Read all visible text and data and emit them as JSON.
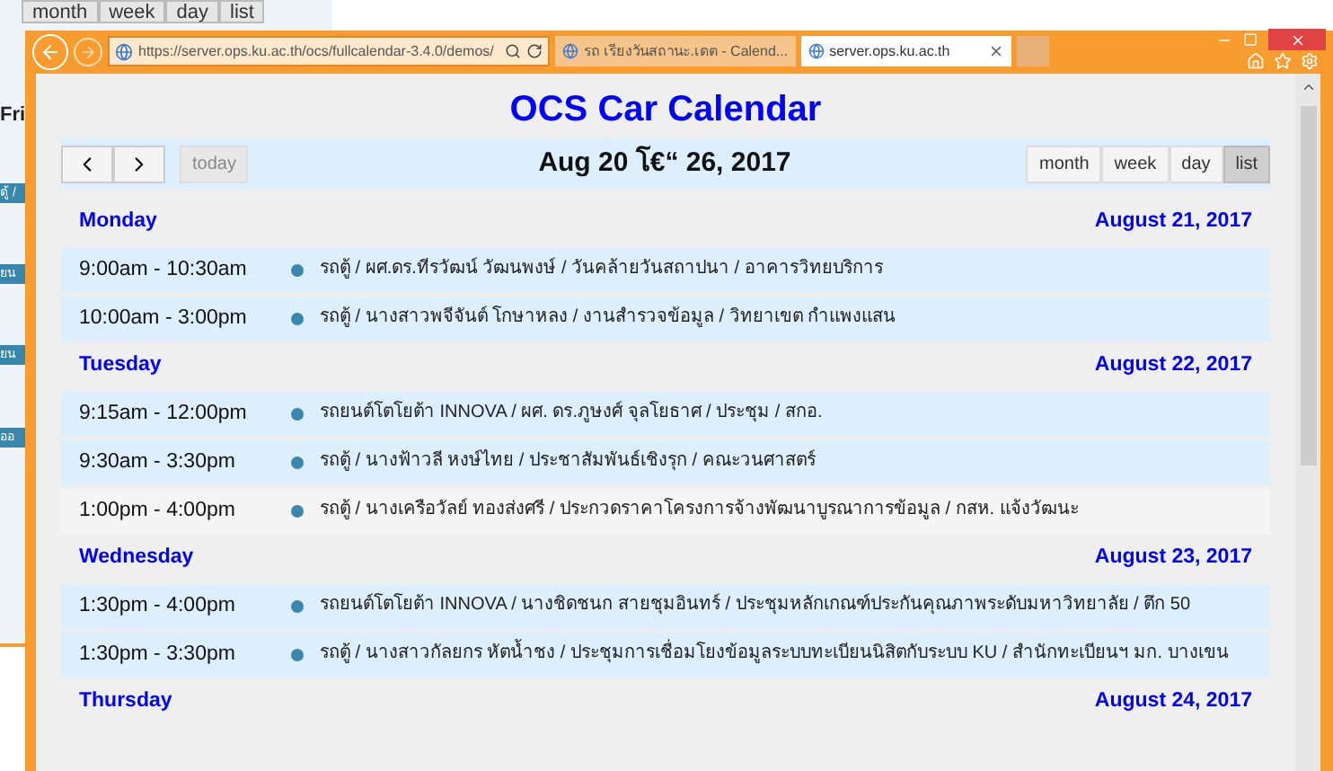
{
  "background_window": {
    "view_buttons": [
      "month",
      "week",
      "day",
      "list"
    ],
    "day_label": "Fri",
    "event_fragments": [
      "ตู้ /",
      "ยน",
      "ยน",
      "ออ"
    ]
  },
  "browser": {
    "address": "https://server.ops.ku.ac.th/ocs/fullcalendar-3.4.0/demos/",
    "tabs": [
      {
        "label": "รถ เรียงวันสถานะ.เดต - Calend...",
        "selected": false
      },
      {
        "label": "server.ops.ku.ac.th",
        "selected": true
      }
    ]
  },
  "calendar": {
    "title": "OCS Car Calendar",
    "range": "Aug 20 โ€“ 26, 2017",
    "today_button": {
      "label": "today",
      "disabled": true
    },
    "views": [
      {
        "label": "month",
        "selected": false
      },
      {
        "label": "week",
        "selected": false
      },
      {
        "label": "day",
        "selected": false
      },
      {
        "label": "list",
        "selected": true
      }
    ],
    "days": [
      {
        "weekday": "Monday",
        "date": "August 21, 2017",
        "events": [
          {
            "time": "9:00am - 10:30am",
            "title": "รถตู้ / ผศ.ดร.ทีรวัฒน์ วัฒนพงษ์ / วันคล้ายวันสถาปนา / อาคารวิทยบริการ",
            "hovered": false
          },
          {
            "time": "10:00am - 3:00pm",
            "title": "รถตู้ / นางสาวพจีจันต์ โกษาหลง / งานสำรวจข้อมูล / วิทยาเขต กำแพงแสน",
            "hovered": false
          }
        ]
      },
      {
        "weekday": "Tuesday",
        "date": "August 22, 2017",
        "events": [
          {
            "time": "9:15am - 12:00pm",
            "title": "รถยนต์โตโยต้า INNOVA / ผศ. ดร.ภูษงศ์ จุลโยธาศ / ประชุม / สกอ.",
            "hovered": false
          },
          {
            "time": "9:30am - 3:30pm",
            "title": "รถตู้ / นางฟ้าวลี หงษ์ไทย / ประชาสัมพันธ์เชิงรุก / คณะวนศาสตร์",
            "hovered": false
          },
          {
            "time": "1:00pm - 4:00pm",
            "title": "รถตู้ / นางเครือวัลย์ ทองส่งศรี / ประกวดราคาโครงการจ้างพัฒนาบูรณาการข้อมูล / กสห. แจ้งวัฒนะ",
            "hovered": true
          }
        ]
      },
      {
        "weekday": "Wednesday",
        "date": "August 23, 2017",
        "events": [
          {
            "time": "1:30pm - 4:00pm",
            "title": "รถยนต์โตโยต้า INNOVA / นางชิดชนก สายชุมอินทร์ / ประชุมหลักเกณฑ์ประกันคุณภาพระดับมหาวิทยาลัย / ตึก 50",
            "hovered": false
          },
          {
            "time": "1:30pm - 3:30pm",
            "title": "รถตู้ / นางสาวกัลยกร หัตน้ำชง / ประชุมการเชื่อมโยงข้อมูลระบบทะเบียนนิสิตกับระบบ KU / สำนักทะเบียนฯ มก. บางเขน",
            "hovered": false
          }
        ]
      },
      {
        "weekday": "Thursday",
        "date": "August 24, 2017"
      }
    ]
  }
}
